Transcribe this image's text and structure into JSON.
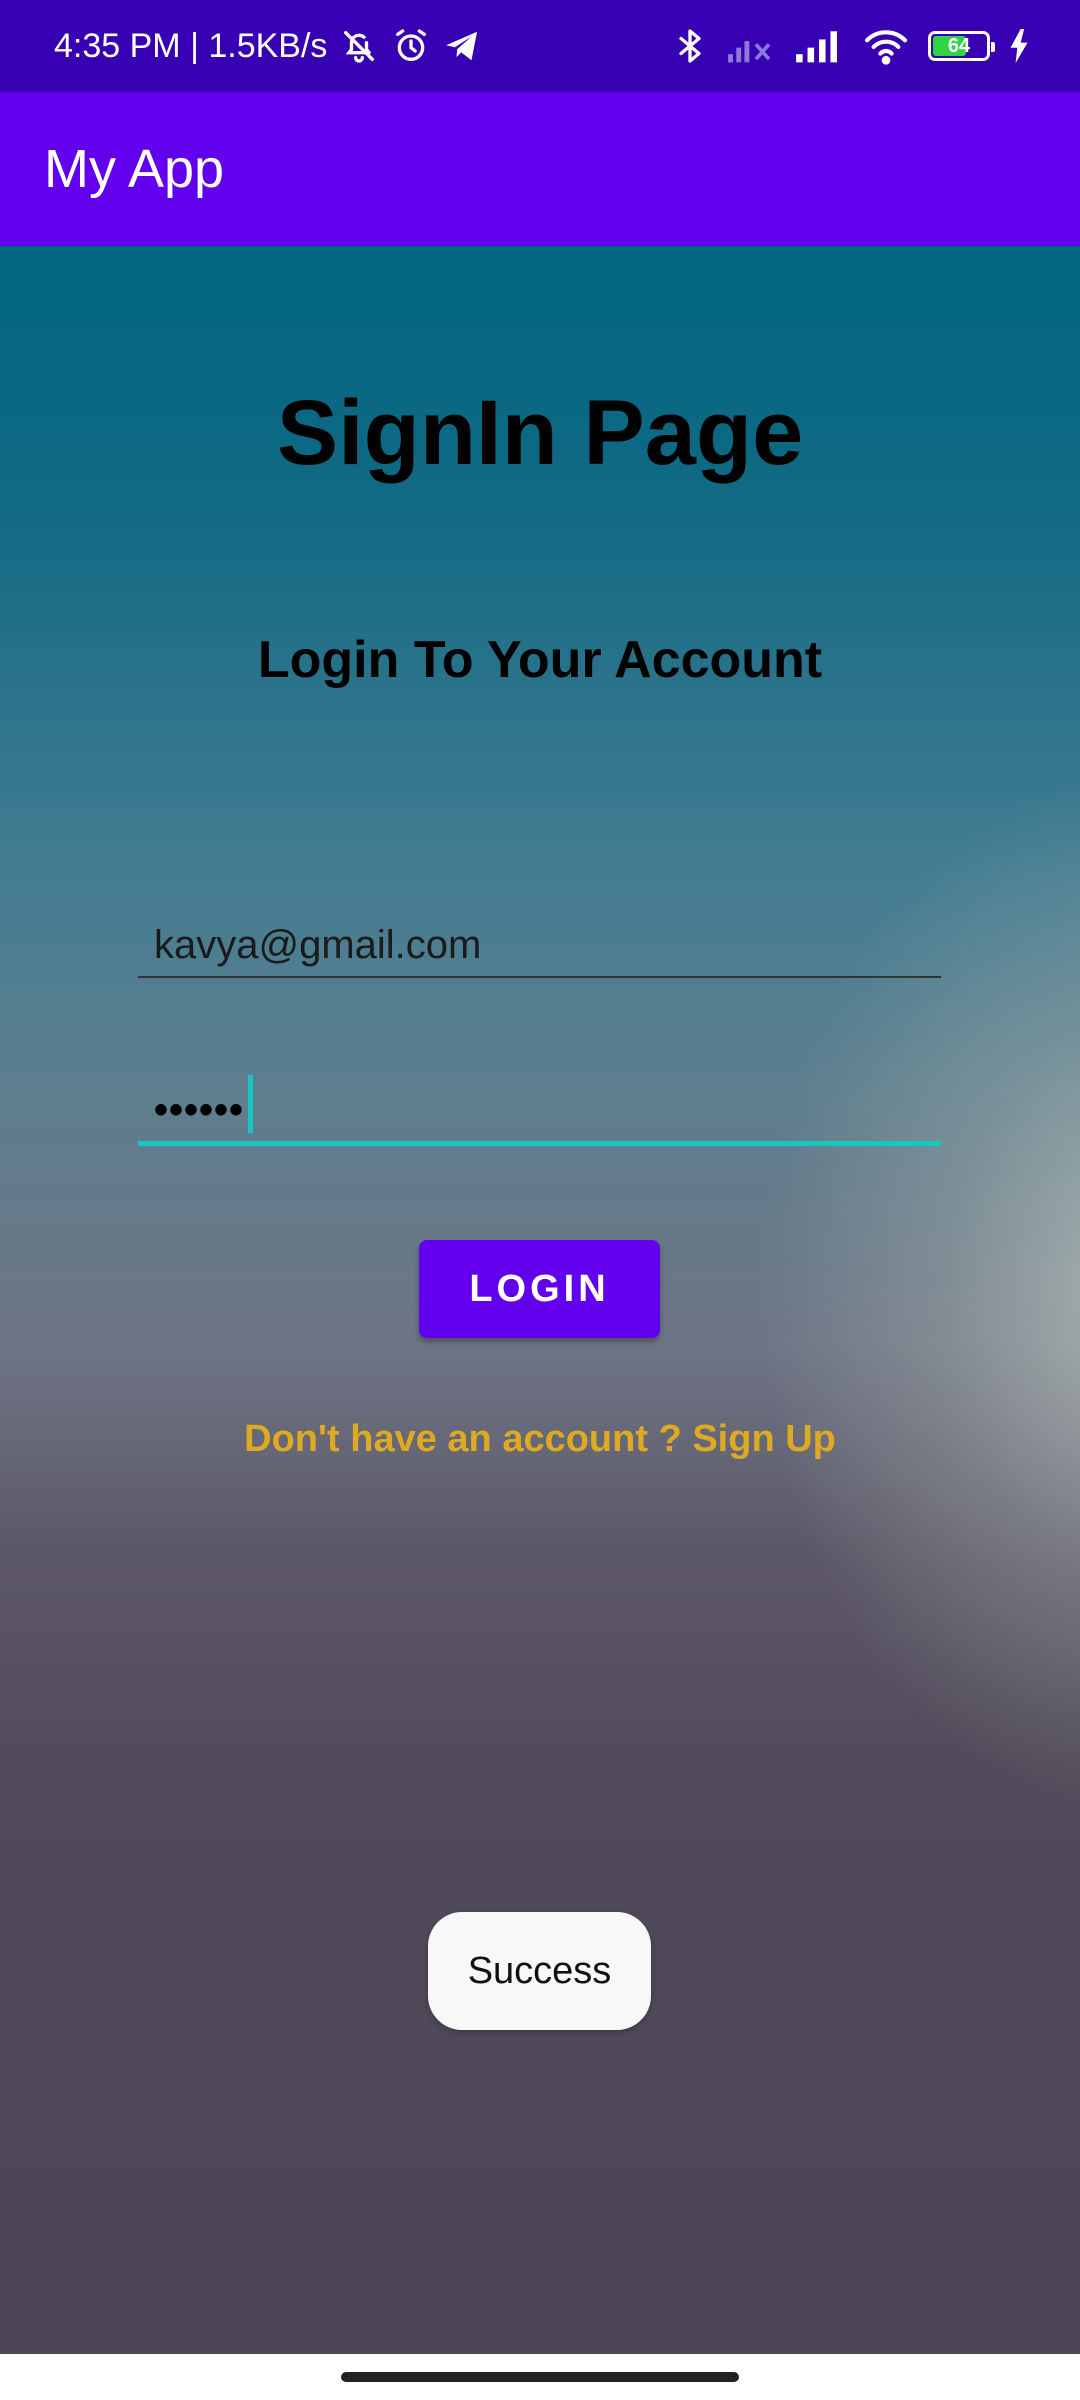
{
  "status_bar": {
    "time_speed": "4:35 PM | 1.5KB/s",
    "battery_level": "64",
    "battery_fraction": 0.64,
    "icons": [
      "mute-bell-icon",
      "alarm-icon",
      "telegram-icon",
      "bluetooth-icon",
      "signal-off-icon",
      "signal-icon",
      "wifi-icon",
      "battery-icon",
      "charging-icon"
    ]
  },
  "app_bar": {
    "title": "My App"
  },
  "main": {
    "title": "SignIn Page",
    "subtitle": "Login To Your Account",
    "email_value": "kavya@gmail.com",
    "password_value": "••••••",
    "login_label": "LOGIN",
    "signup_text": "Don't have an account ? Sign Up"
  },
  "toast": {
    "message": "Success"
  },
  "colors": {
    "primary": "#6200ee",
    "primary_dark": "#3700b3",
    "accent": "#16c9c0",
    "link": "#ddaa22"
  }
}
